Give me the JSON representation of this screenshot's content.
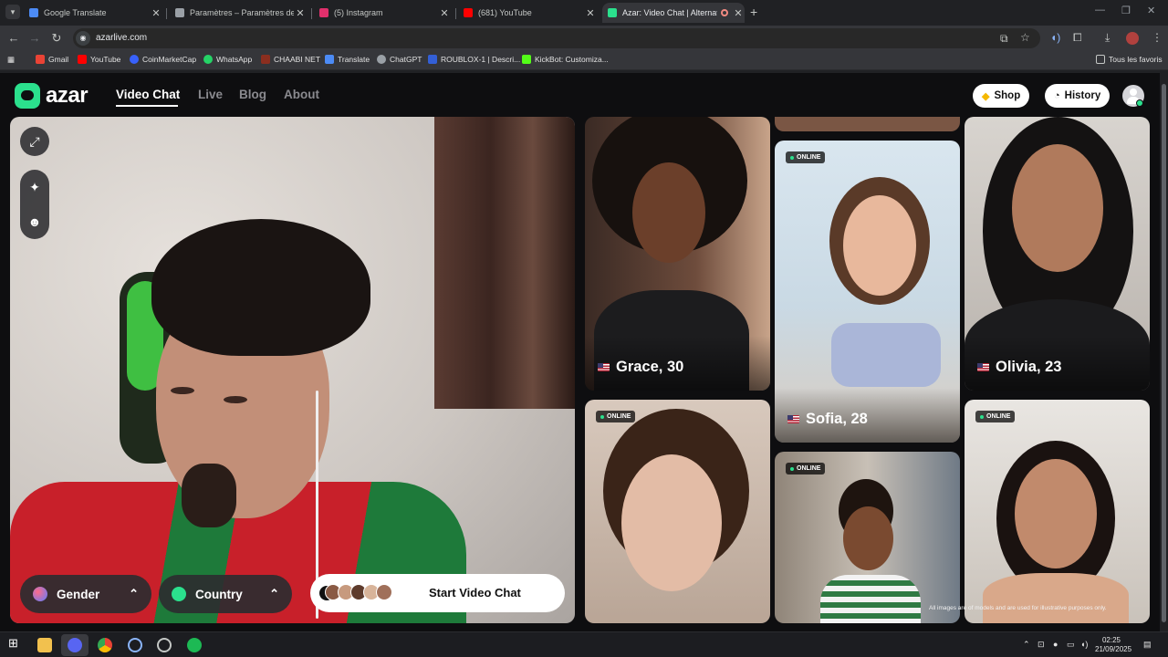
{
  "browser": {
    "tabs": [
      {
        "title": "Google Translate",
        "favicon_color": "#4c8bf5"
      },
      {
        "title": "Paramètres – Paramètres des sit",
        "favicon_color": "#9aa0a6"
      },
      {
        "title": "(5) Instagram",
        "favicon_color": "#e1306c"
      },
      {
        "title": "(681) YouTube",
        "favicon_color": "#ff0000"
      },
      {
        "title": "Azar: Video Chat | Alternati",
        "favicon_color": "#2be08d"
      }
    ],
    "url": "azarlive.com",
    "bookmarks": [
      {
        "label": "Gmail",
        "color": "#ea4335"
      },
      {
        "label": "YouTube",
        "color": "#ff0000"
      },
      {
        "label": "CoinMarketCap",
        "color": "#3861fb"
      },
      {
        "label": "WhatsApp",
        "color": "#25d366"
      },
      {
        "label": "CHAABI NET",
        "color": "#8b2e1f"
      },
      {
        "label": "Translate",
        "color": "#4c8bf5"
      },
      {
        "label": "ChatGPT",
        "color": "#9aa0a6"
      },
      {
        "label": "ROUBLOX-1 | Descri...",
        "color": "#335fd6"
      },
      {
        "label": "KickBot: Customiza...",
        "color": "#53fc18"
      }
    ],
    "all_bookmarks": "Tous les favoris"
  },
  "site": {
    "brand": "azar",
    "nav": [
      "Video Chat",
      "Live",
      "Blog",
      "About"
    ],
    "shop": "Shop",
    "history": "History"
  },
  "controls": {
    "gender": "Gender",
    "country": "Country",
    "start": "Start Video Chat"
  },
  "profiles": [
    {
      "name": "Grace, 30",
      "online": false
    },
    {
      "name": "Sofia, 28",
      "online": true
    },
    {
      "name": "Olivia, 23",
      "online": false
    },
    {
      "name": "",
      "online": true
    },
    {
      "name": "",
      "online": true
    },
    {
      "name": "",
      "online": true
    }
  ],
  "online_label": "ONLINE",
  "disclaimer": "All images are of models and are used for illustrative purposes only.",
  "taskbar": {
    "time": "02:25",
    "date": "21/09/2025"
  }
}
